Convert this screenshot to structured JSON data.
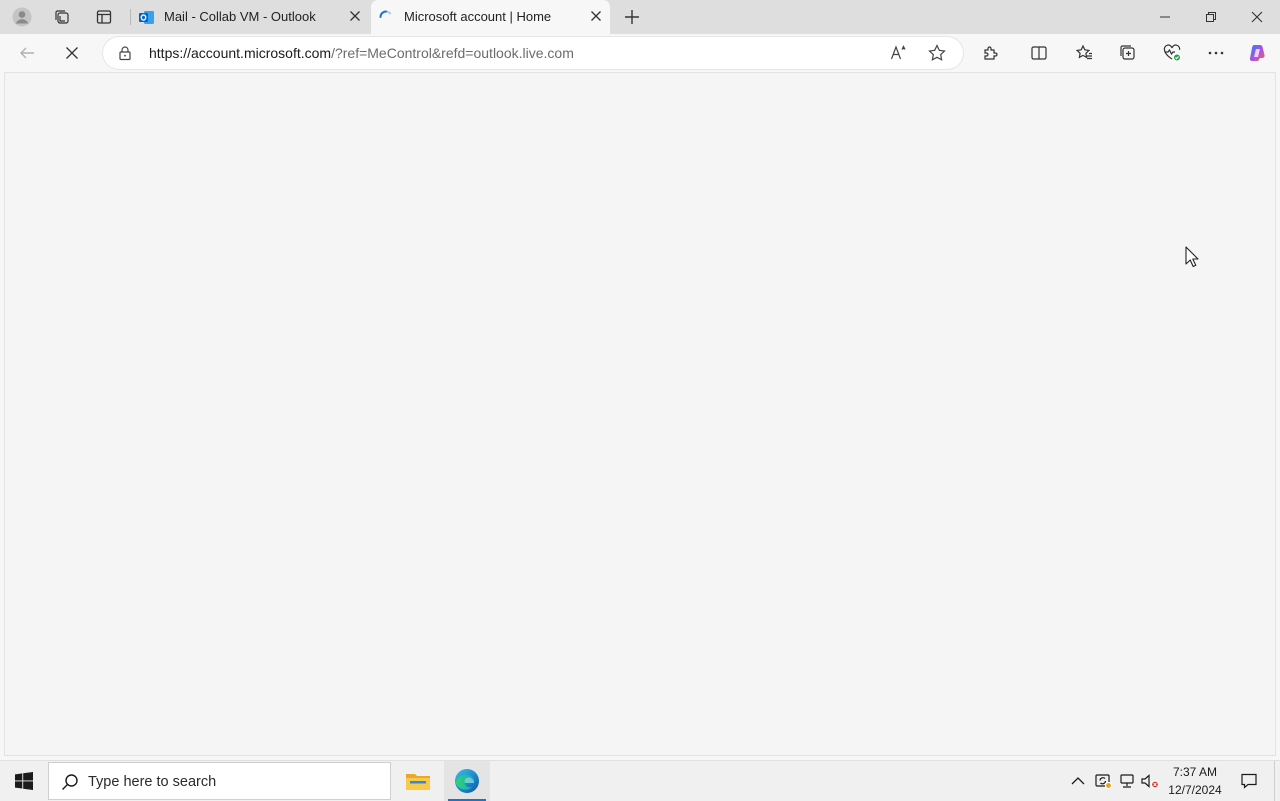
{
  "browser": {
    "tabs": [
      {
        "title": "Mail - Collab VM - Outlook",
        "favicon": "outlook-icon",
        "active": false
      },
      {
        "title": "Microsoft account | Home",
        "favicon": "loading-spinner-icon",
        "active": true
      }
    ],
    "address": {
      "url_host": "https://account.microsoft.com",
      "url_rest": "/?ref=MeControl&refd=outlook.live.com"
    },
    "page_state": "loading"
  },
  "taskbar": {
    "search_placeholder": "Type here to search",
    "pinned_apps": [
      "file-explorer-icon",
      "edge-icon"
    ],
    "clock": {
      "time": "7:37 AM",
      "date": "12/7/2024"
    }
  },
  "colors": {
    "accent": "#1c74c8",
    "tabstrip": "#dedede",
    "content_bg": "#f5f5f5",
    "copilot_gradient": [
      "#2f7df5",
      "#b34fe0",
      "#f06b3f"
    ]
  }
}
